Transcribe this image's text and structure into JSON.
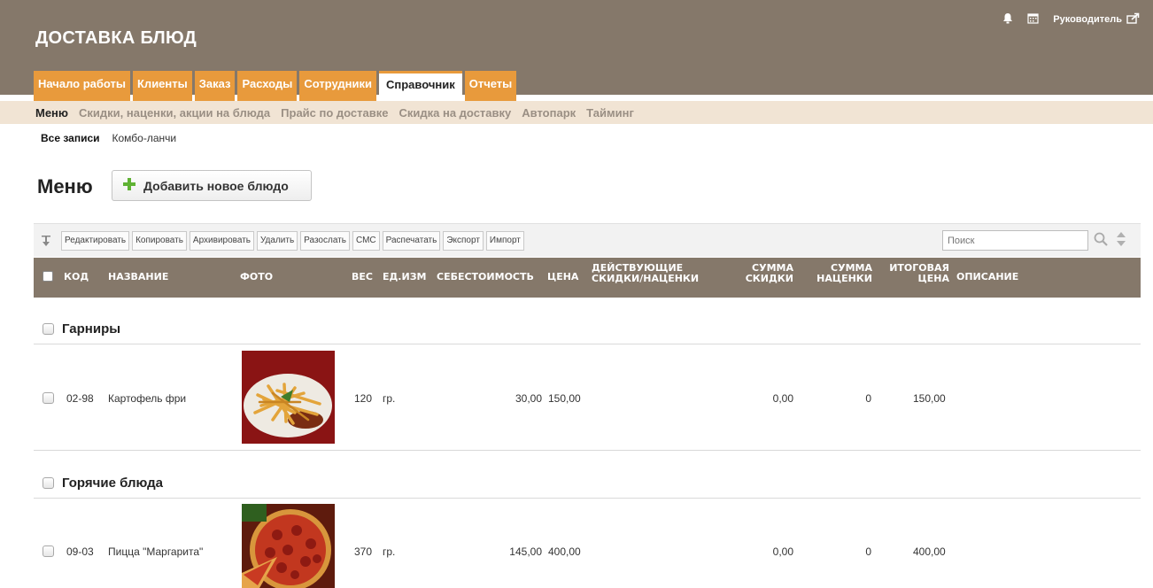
{
  "app": {
    "title": "ДОСТАВКА БЛЮД",
    "user": "Руководитель"
  },
  "tabs": [
    {
      "label": "Начало работы"
    },
    {
      "label": "Клиенты"
    },
    {
      "label": "Заказ"
    },
    {
      "label": "Расходы"
    },
    {
      "label": "Сотрудники"
    },
    {
      "label": "Справочник",
      "active": true
    },
    {
      "label": "Отчеты"
    }
  ],
  "subnav": [
    {
      "label": "Меню",
      "active": true
    },
    {
      "label": "Скидки, наценки, акции на блюда"
    },
    {
      "label": "Прайс по доставке"
    },
    {
      "label": "Скидка на доставку"
    },
    {
      "label": "Автопарк"
    },
    {
      "label": "Тайминг"
    }
  ],
  "filters": [
    {
      "label": "Все записи",
      "active": true
    },
    {
      "label": "Комбо-ланчи"
    }
  ],
  "page": {
    "title": "Меню",
    "add_button": "Добавить новое блюдо"
  },
  "toolbar": {
    "buttons": [
      "Редактировать",
      "Копировать",
      "Архивировать",
      "Удалить",
      "Разослать",
      "СМС",
      "Распечатать",
      "Экспорт",
      "Импорт"
    ],
    "search_placeholder": "Поиск"
  },
  "columns": {
    "code": "КОД",
    "name": "НАЗВАНИЕ",
    "photo": "ФОТО",
    "weight": "ВЕС",
    "unit": "ЕД.ИЗМ",
    "cost": "СЕБЕСТОИМОСТЬ",
    "price": "ЦЕНА",
    "discounts_1": "ДЕЙСТВУЮЩИЕ",
    "discounts_2": "СКИДКИ/НАЦЕНКИ",
    "disc_sum_1": "СУММА",
    "disc_sum_2": "СКИДКИ",
    "markup_sum_1": "СУММА",
    "markup_sum_2": "НАЦЕНКИ",
    "final_1": "ИТОГОВАЯ",
    "final_2": "ЦЕНА",
    "description": "ОПИСАНИЕ"
  },
  "groups": [
    {
      "name": "Гарниры",
      "rows": [
        {
          "code": "02-98",
          "name": "Картофель фри",
          "weight": "120",
          "unit": "гр.",
          "cost": "30,00",
          "price": "150,00",
          "discount": "0,00",
          "markup": "0",
          "final": "150,00"
        }
      ]
    },
    {
      "name": "Горячие блюда",
      "rows": [
        {
          "code": "09-03",
          "name": "Пицца \"Маргарита\"",
          "weight": "370",
          "unit": "гр.",
          "cost": "145,00",
          "price": "400,00",
          "discount": "0,00",
          "markup": "0",
          "final": "400,00"
        }
      ]
    }
  ],
  "icons": [
    "bell-icon",
    "calendar-icon",
    "logout-icon",
    "plus-icon",
    "sort-down-icon",
    "search-icon",
    "sort-icon"
  ],
  "colors": {
    "header": "#85786a",
    "tab": "#e89a3c",
    "subnav": "#f1e4d4",
    "add_icon": "#5fb233"
  }
}
